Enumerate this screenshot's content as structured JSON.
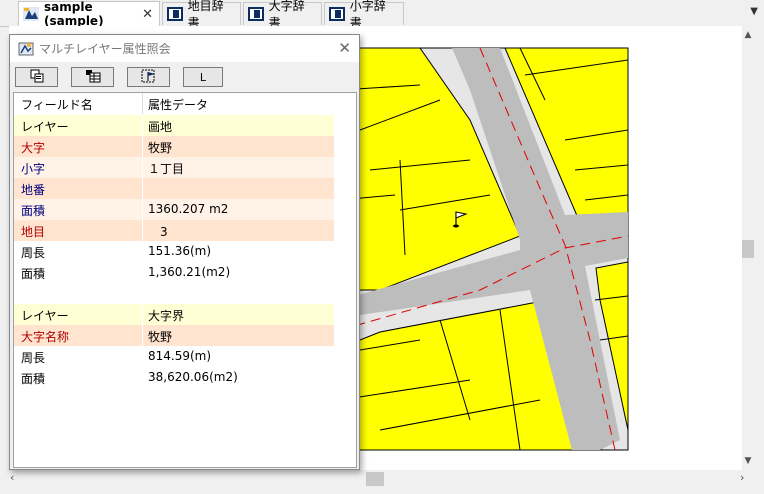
{
  "tabs": [
    {
      "label": "sample (sample)",
      "active": true,
      "close": "✕"
    },
    {
      "label": "地目辞書"
    },
    {
      "label": "大字辞書"
    },
    {
      "label": "小字辞書"
    }
  ],
  "tab_menu_icon": "chevron-down-icon",
  "dialog": {
    "title": "マルチレイヤー属性照会",
    "close": "✕",
    "toolbar": [
      {
        "icon": "copy-icon"
      },
      {
        "icon": "table-icon"
      },
      {
        "icon": "flag-select-icon"
      },
      {
        "label": "L"
      }
    ],
    "columns": [
      "フィールド名",
      "属性データ"
    ],
    "rows": [
      {
        "field": "レイヤー",
        "value": "画地",
        "bg": "#ffffd5",
        "fc": "#000000"
      },
      {
        "field": "大字",
        "value": "牧野",
        "bg": "#ffe4cf",
        "fc": "#b00000"
      },
      {
        "field": "小字",
        "value": "１丁目",
        "bg": "#fff3e8",
        "fc": "#00007a"
      },
      {
        "field": "地番",
        "value": "",
        "bg": "#ffe4cf",
        "fc": "#00007a"
      },
      {
        "field": "面積",
        "value": "1360.207 m2",
        "bg": "#fff3e8",
        "fc": "#00007a"
      },
      {
        "field": "地目",
        "value": "　3",
        "bg": "#ffe4cf",
        "fc": "#b00000"
      },
      {
        "field": "周長",
        "value": "151.36(m)",
        "bg": "#ffffff",
        "fc": "#000000"
      },
      {
        "field": "面積",
        "value": "1,360.21(m2)",
        "bg": "#ffffff",
        "fc": "#000000"
      },
      {
        "field": "",
        "value": "",
        "bg": "#ffffff",
        "fc": "#000000"
      },
      {
        "field": "レイヤー",
        "value": "大字界",
        "bg": "#ffffd5",
        "fc": "#000000"
      },
      {
        "field": "大字名称",
        "value": "牧野",
        "bg": "#ffe4cf",
        "fc": "#b00000"
      },
      {
        "field": "周長",
        "value": "814.59(m)",
        "bg": "#ffffff",
        "fc": "#000000"
      },
      {
        "field": "面積",
        "value": "38,620.06(m2)",
        "bg": "#ffffff",
        "fc": "#000000"
      }
    ]
  },
  "map": {
    "parcel_color": "#ffff00",
    "road_color": "#c0c0c0",
    "sidewalk_color": "#e6e6e6",
    "boundary_color": "#e00000"
  }
}
